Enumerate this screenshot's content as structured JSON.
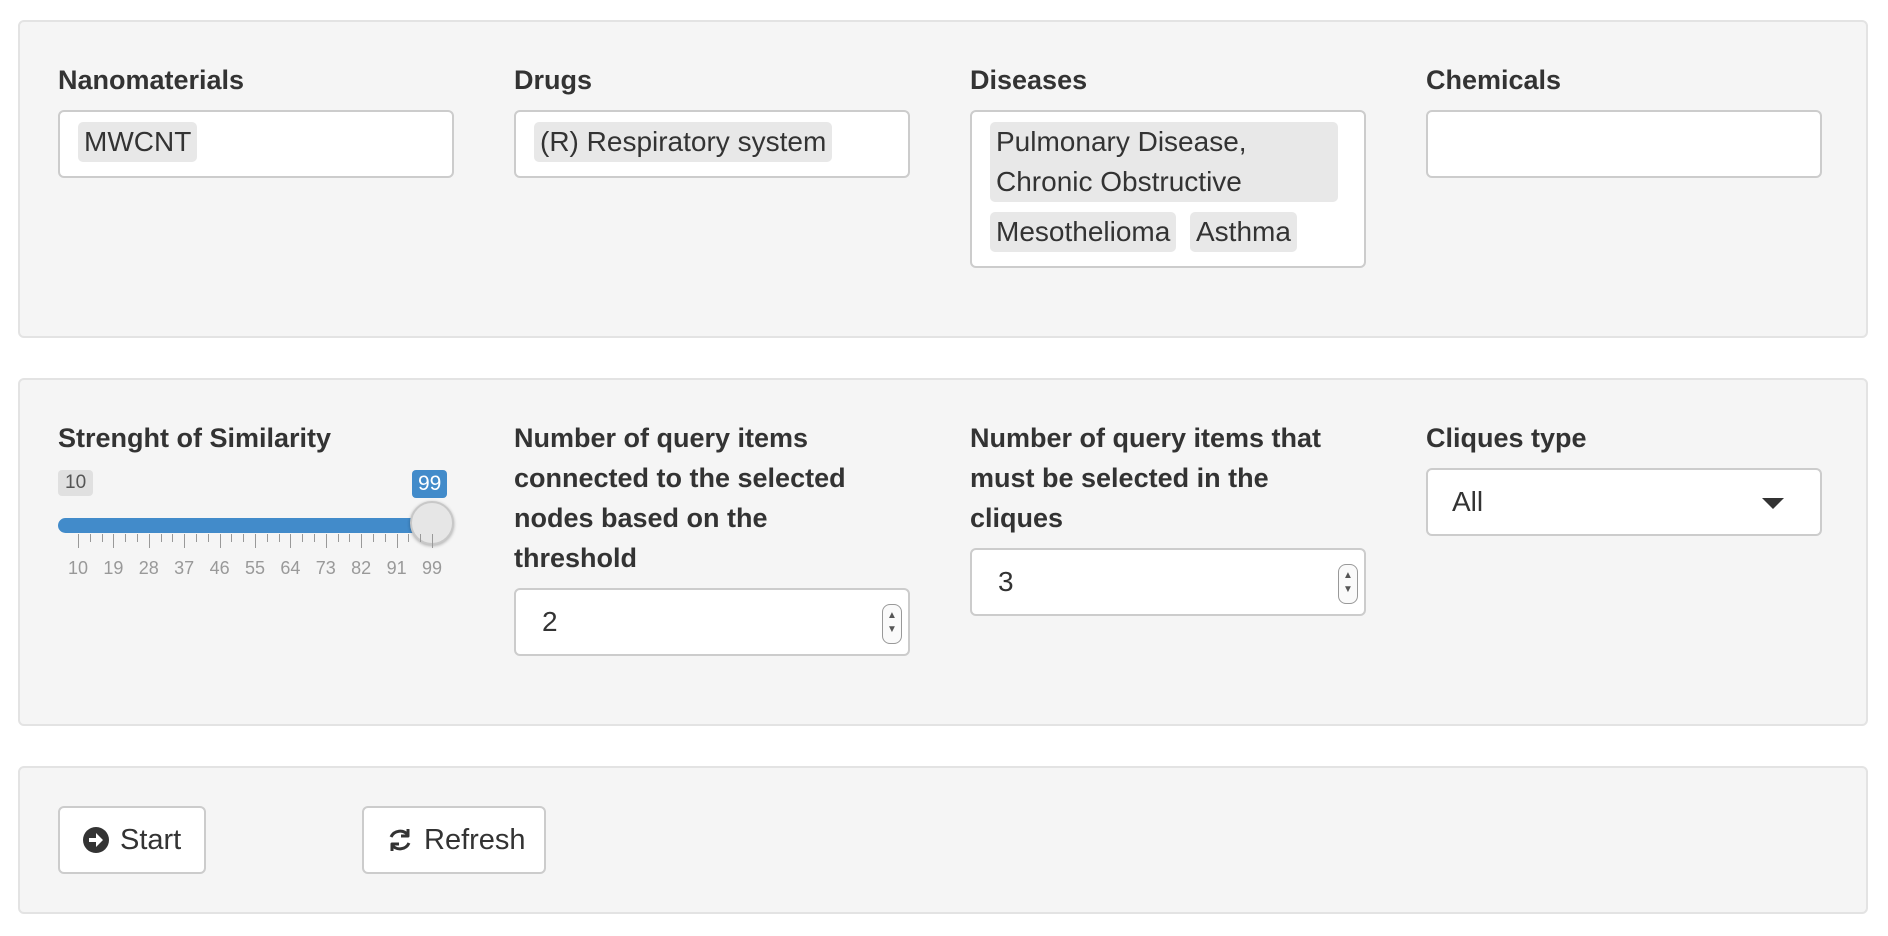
{
  "selectors": {
    "nanomaterials": {
      "label": "Nanomaterials",
      "chips": [
        "MWCNT"
      ]
    },
    "drugs": {
      "label": "Drugs",
      "chips": [
        "(R) Respiratory system"
      ]
    },
    "diseases": {
      "label": "Diseases",
      "chips": [
        "Pulmonary Disease, Chronic Obstructive",
        "Mesothelioma",
        "Asthma"
      ]
    },
    "chemicals": {
      "label": "Chemicals",
      "chips": []
    }
  },
  "similarity": {
    "label": "Strenght of Similarity",
    "min": 10,
    "max": 99,
    "value": 99,
    "min_label": "10",
    "value_label": "99",
    "ticks": [
      "10",
      "19",
      "28",
      "37",
      "46",
      "55",
      "64",
      "73",
      "82",
      "91",
      "99"
    ]
  },
  "connected": {
    "label": "Number of query items connected to the selected nodes based on the threshold",
    "value": "2"
  },
  "must_select": {
    "label": "Number of query items that must be selected in the cliques",
    "value": "3"
  },
  "cliques": {
    "label": "Cliques type",
    "selected": "All"
  },
  "buttons": {
    "start": "Start",
    "refresh": "Refresh"
  },
  "colors": {
    "accent": "#428bca",
    "well_bg": "#f5f5f5",
    "chip_bg": "#e8e8e8"
  }
}
